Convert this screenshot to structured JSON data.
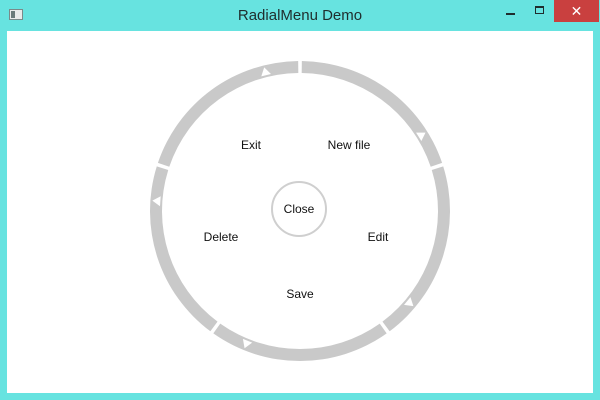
{
  "window": {
    "title": "RadialMenu Demo",
    "accent_color": "#67e3e0",
    "close_button_color": "#c9403f",
    "close_glyph": "✕"
  },
  "menu": {
    "center_label": "Close",
    "items": [
      {
        "label": "Exit"
      },
      {
        "label": "New file"
      },
      {
        "label": "Delete"
      },
      {
        "label": "Edit"
      },
      {
        "label": "Save"
      }
    ],
    "ring_color": "#c9c9c9",
    "arrow_color": "#ffffff"
  }
}
